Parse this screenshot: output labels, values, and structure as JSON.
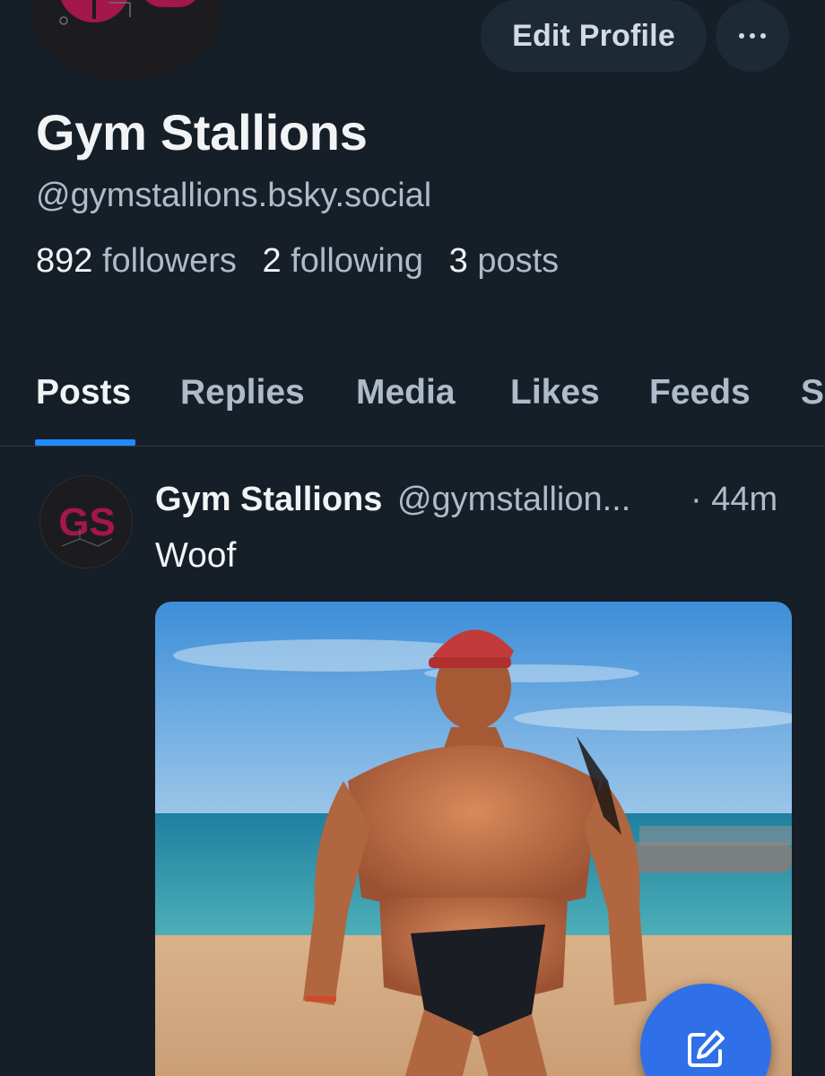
{
  "profile": {
    "display_name": "Gym Stallions",
    "handle": "@gymstallions.bsky.social",
    "avatar_logo_text": "GS",
    "stats": {
      "followers_count": "892",
      "followers_label": "followers",
      "following_count": "2",
      "following_label": "following",
      "posts_count": "3",
      "posts_label": "posts"
    }
  },
  "actions": {
    "edit_profile_label": "Edit Profile",
    "more_icon": "ellipsis-icon"
  },
  "tabs": [
    {
      "label": "Posts",
      "active": true
    },
    {
      "label": "Replies",
      "active": false
    },
    {
      "label": "Media",
      "active": false
    },
    {
      "label": "Likes",
      "active": false
    },
    {
      "label": "Feeds",
      "active": false
    },
    {
      "label": "S",
      "active": false
    }
  ],
  "post": {
    "author": "Gym Stallions",
    "handle": "@gymstallion...",
    "time": "· 44m",
    "text": "Woof"
  },
  "fab": {
    "icon": "compose-icon"
  },
  "colors": {
    "background": "#161e27",
    "accent": "#208bfe",
    "fab": "#2f6fe8",
    "logo": "#a3174a"
  }
}
